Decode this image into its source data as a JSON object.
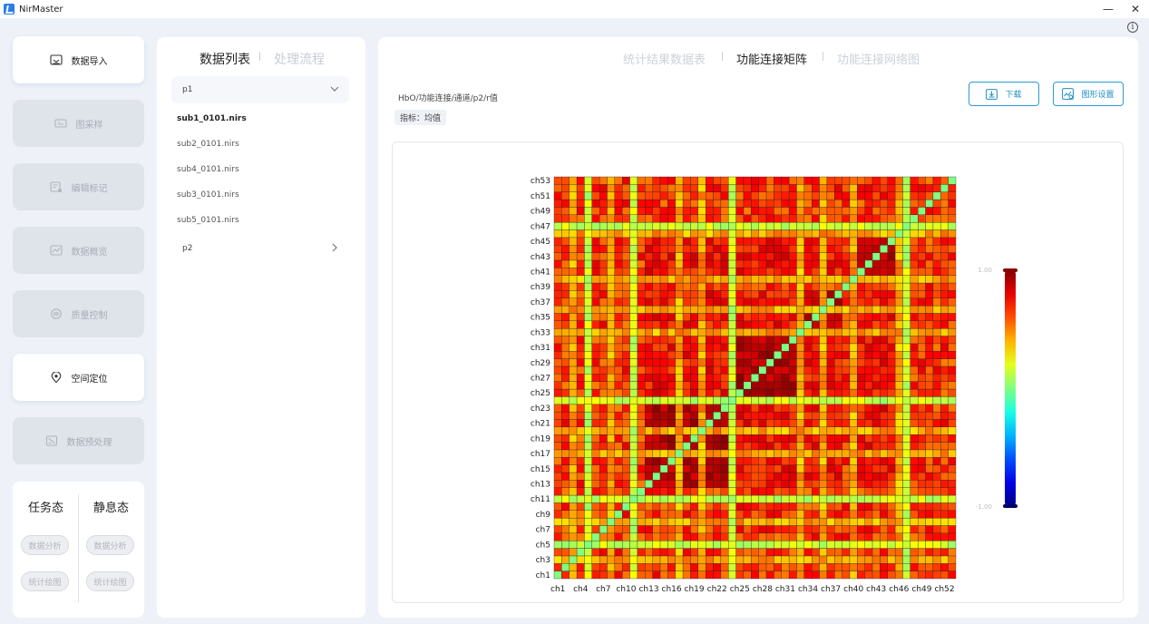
{
  "window": {
    "title": "NirMaster",
    "minimize": "—",
    "close": "✕",
    "info": "i"
  },
  "nav": {
    "items": [
      {
        "label": "数据导入",
        "state": "active",
        "icon": "import-icon"
      },
      {
        "label": "图采样",
        "state": "disabled",
        "icon": "sampling-icon"
      },
      {
        "label": "编辑标记",
        "state": "disabled",
        "icon": "edit-marker-icon"
      },
      {
        "label": "数据概览",
        "state": "disabled",
        "icon": "overview-icon"
      },
      {
        "label": "质量控制",
        "state": "disabled",
        "icon": "quality-icon"
      },
      {
        "label": "空间定位",
        "state": "active",
        "icon": "location-icon"
      },
      {
        "label": "数据预处理",
        "state": "disabled",
        "icon": "preprocess-icon"
      }
    ],
    "task_mode": {
      "title": "任务态",
      "analysis": "数据分析",
      "plot": "统计绘图"
    },
    "rest_mode": {
      "title": "静息态",
      "analysis": "数据分析",
      "plot": "统计绘图"
    }
  },
  "data_list": {
    "tab_active": "数据列表",
    "tab_inactive": "处理流程",
    "groups": [
      {
        "name": "p1",
        "expanded": true,
        "files": [
          "sub1_0101.nirs",
          "sub2_0101.nirs",
          "sub4_0101.nirs",
          "sub3_0101.nirs",
          "sub5_0101.nirs"
        ],
        "selected": "sub1_0101.nirs"
      },
      {
        "name": "p2",
        "expanded": false
      }
    ]
  },
  "result": {
    "tabs": [
      "统计结果数据表",
      "功能连接矩阵",
      "功能连接网络图"
    ],
    "active_tab": "功能连接矩阵",
    "breadcrumb": "HbO/功能连接/通道/p2/r值",
    "metric": "指标：均值",
    "download_label": "下载",
    "settings_label": "图形设置"
  },
  "colors": {
    "accent": "#1f8fc4",
    "disabled_text": "#a8adb6"
  },
  "chart_data": {
    "type": "heatmap",
    "n_channels": 53,
    "x_tick_labels": [
      "ch1",
      "ch4",
      "ch7",
      "ch10",
      "ch13",
      "ch16",
      "ch19",
      "ch22",
      "ch25",
      "ch28",
      "ch31",
      "ch34",
      "ch37",
      "ch40",
      "ch43",
      "ch46",
      "ch49",
      "ch52"
    ],
    "y_tick_labels": [
      "ch1",
      "ch3",
      "ch5",
      "ch7",
      "ch9",
      "ch11",
      "ch13",
      "ch15",
      "ch17",
      "ch19",
      "ch21",
      "ch23",
      "ch25",
      "ch27",
      "ch29",
      "ch31",
      "ch33",
      "ch35",
      "ch37",
      "ch39",
      "ch41",
      "ch43",
      "ch45",
      "ch47",
      "ch49",
      "ch51",
      "ch53"
    ],
    "diagonal_value": 0.0,
    "weak_channels": [
      5,
      11,
      24,
      47
    ],
    "semi_weak_channels": [
      3,
      8,
      17,
      20,
      33,
      36,
      40,
      46
    ],
    "strong_blocks": [
      [
        13,
        23
      ],
      [
        25,
        32
      ],
      [
        34,
        38
      ],
      [
        41,
        45
      ]
    ],
    "colorbar": {
      "max_label": "1.00",
      "min_label": "-1.00",
      "vmin": -1,
      "vmax": 1,
      "colormap": "jet"
    }
  }
}
